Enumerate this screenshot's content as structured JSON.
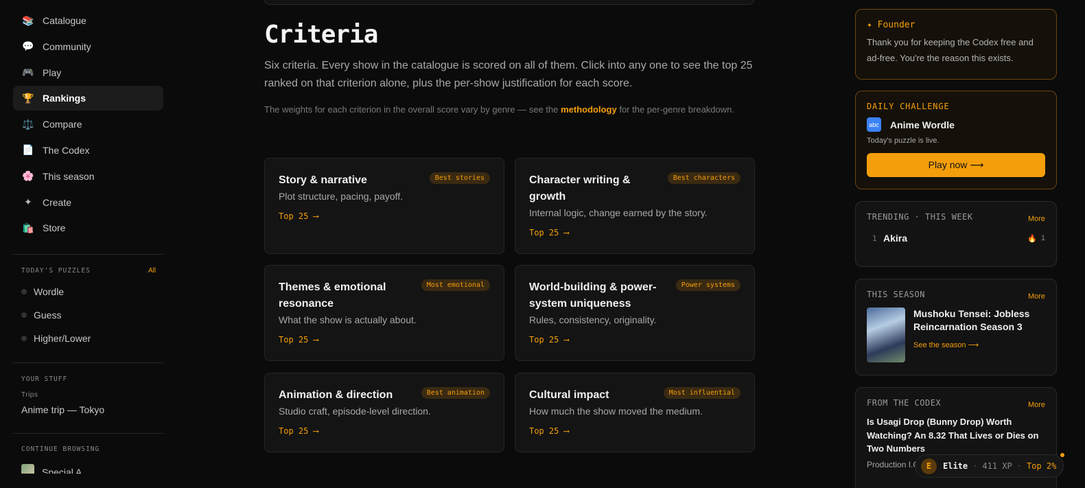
{
  "nav": {
    "items": [
      {
        "label": "Catalogue",
        "icon": "catalogue-icon",
        "glyph": "📚"
      },
      {
        "label": "Community",
        "icon": "community-icon",
        "glyph": "💬"
      },
      {
        "label": "Play",
        "icon": "play-icon",
        "glyph": "🎮"
      },
      {
        "label": "Rankings",
        "icon": "rankings-icon",
        "glyph": "🏆"
      },
      {
        "label": "Compare",
        "icon": "compare-icon",
        "glyph": "⚖️"
      },
      {
        "label": "The Codex",
        "icon": "codex-icon",
        "glyph": "📄"
      },
      {
        "label": "This season",
        "icon": "season-icon",
        "glyph": "🌸"
      },
      {
        "label": "Create",
        "icon": "create-icon",
        "glyph": "✦"
      },
      {
        "label": "Store",
        "icon": "store-icon",
        "glyph": "🛍️"
      }
    ],
    "active": "Rankings"
  },
  "puzzles": {
    "label": "TODAY'S PUZZLES",
    "all_link": "All",
    "items": [
      "Wordle",
      "Guess",
      "Higher/Lower"
    ]
  },
  "your_stuff": {
    "label": "YOUR STUFF",
    "sub_label": "Trips",
    "trip": "Anime trip — Tokyo"
  },
  "continue": {
    "label": "CONTINUE BROWSING",
    "item": "Special A"
  },
  "main": {
    "title": "Criteria",
    "intro": "Six criteria. Every show in the catalogue is scored on all of them. Click into any one to see the top 25 ranked on that criterion alone, plus the per-show justification for each score.",
    "note_before": "The weights for each criterion in the overall score vary by genre — see the ",
    "note_link": "methodology",
    "note_after": " for the per-genre breakdown.",
    "criteria": [
      {
        "title": "Story & narrative",
        "desc": "Plot structure, pacing, payoff.",
        "badge": "Best stories",
        "link": "Top 25 ⟶"
      },
      {
        "title": "Character writing & growth",
        "desc": "Internal logic, change earned by the story.",
        "badge": "Best characters",
        "link": "Top 25 ⟶"
      },
      {
        "title": "Themes & emotional resonance",
        "desc": "What the show is actually about.",
        "badge": "Most emotional",
        "link": "Top 25 ⟶"
      },
      {
        "title": "World-building & power-system uniqueness",
        "desc": "Rules, consistency, originality.",
        "badge": "Power systems",
        "link": "Top 25 ⟶"
      },
      {
        "title": "Animation & direction",
        "desc": "Studio craft, episode-level direction.",
        "badge": "Best animation",
        "link": "Top 25 ⟶"
      },
      {
        "title": "Cultural impact",
        "desc": "How much the show moved the medium.",
        "badge": "Most influential",
        "link": "Top 25 ⟶"
      }
    ]
  },
  "right": {
    "founder": {
      "title": "✦ Founder",
      "text": "Thank you for keeping the Codex free and ad-free. You're the reason this exists."
    },
    "daily": {
      "label": "DAILY CHALLENGE",
      "icon_text": "abc",
      "name": "Anime Wordle",
      "sub": "Today's puzzle is live.",
      "button": "Play now ⟶"
    },
    "trending": {
      "label": "TRENDING · THIS WEEK",
      "more": "More",
      "items": [
        {
          "rank": "1",
          "name": "Akira",
          "count": "1",
          "icon": "flame-icon",
          "glyph": "🔥"
        }
      ]
    },
    "season": {
      "label": "THIS SEASON",
      "more": "More",
      "title": "Mushoku Tensei: Jobless Reincarnation Season 3",
      "link": "See the season ⟶"
    },
    "codex": {
      "label": "FROM THE CODEX",
      "more": "More",
      "title": "Is Usagi Drop (Bunny Drop) Worth Watching? An 8.32 That Lives or Dies on Two Numbers",
      "sub": "Production I.G"
    }
  },
  "xp": {
    "avatar": "E",
    "level": "Elite",
    "sep1": "·",
    "points": "411 XP",
    "sep2": "·",
    "rank": "Top 2%"
  },
  "colors": {
    "accent": "#f59e0b",
    "background": "#0b0b0b",
    "card": "#141414"
  }
}
